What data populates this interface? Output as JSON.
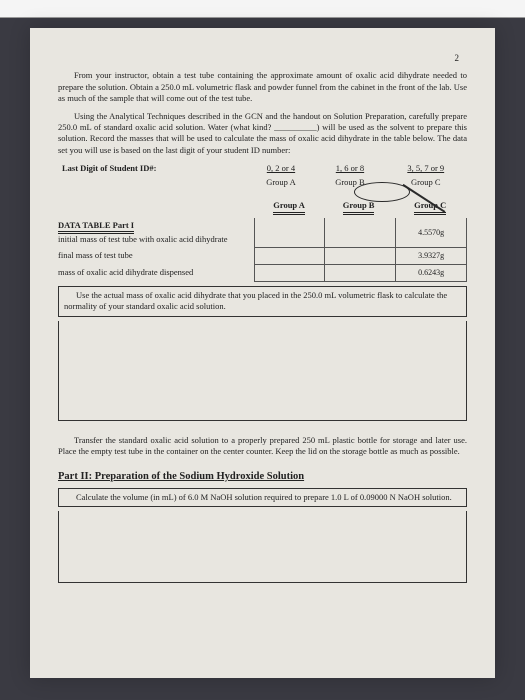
{
  "page_number": "2",
  "para1": "From your instructor, obtain a test tube containing the approximate amount of oxalic acid dihydrate needed to prepare the solution. Obtain a 250.0 mL volumetric flask and powder funnel from the cabinet in the front of the lab. Use as much of the sample that will come out of the test tube.",
  "para2": "Using the Analytical Techniques described in the GCN and the handout on Solution Preparation, carefully prepare 250.0 mL of standard oxalic acid solution. Water (what kind? __________) will be used as the solvent to prepare this solution. Record the masses that will be used to calculate the mass of oxalic acid dihydrate in the table below. The data set you will use is based on the last digit of your student ID number:",
  "id_row": {
    "label": "Last Digit of Student ID#:",
    "opt_a": "0, 2 or 4",
    "opt_b": "1, 6 or 8",
    "opt_c": "3, 5, 7 or 9"
  },
  "group_row": {
    "a": "Group A",
    "b": "Group B",
    "c": "Group C"
  },
  "data_header": {
    "title": "DATA TABLE Part I",
    "col_a": "Group A",
    "col_b": "Group B",
    "col_c": "Group C"
  },
  "rows": {
    "r1": {
      "label": "initial mass of test tube with oxalic acid dihydrate",
      "a": "",
      "b": "",
      "c": "4.5570g"
    },
    "r2": {
      "label": "final mass of test tube",
      "a": "",
      "b": "",
      "c": "3.9327g"
    },
    "r3": {
      "label": "mass of oxalic acid dihydrate dispensed",
      "a": "",
      "b": "",
      "c": "0.6243g"
    }
  },
  "calc_box": "Use the actual mass of oxalic acid dihydrate that you placed in the 250.0 mL volumetric flask to calculate the normality of your standard oxalic acid solution.",
  "transfer_para": "Transfer the standard oxalic acid solution to a properly prepared 250 mL plastic bottle for storage and later use. Place the empty test tube in the container on the center counter. Keep the lid on the storage bottle as much as possible.",
  "part2_title": "Part II:  Preparation of the Sodium Hydroxide Solution",
  "part2_box": "Calculate the volume (in mL) of 6.0 M NaOH solution required to prepare 1.0 L of 0.09000 N NaOH solution."
}
